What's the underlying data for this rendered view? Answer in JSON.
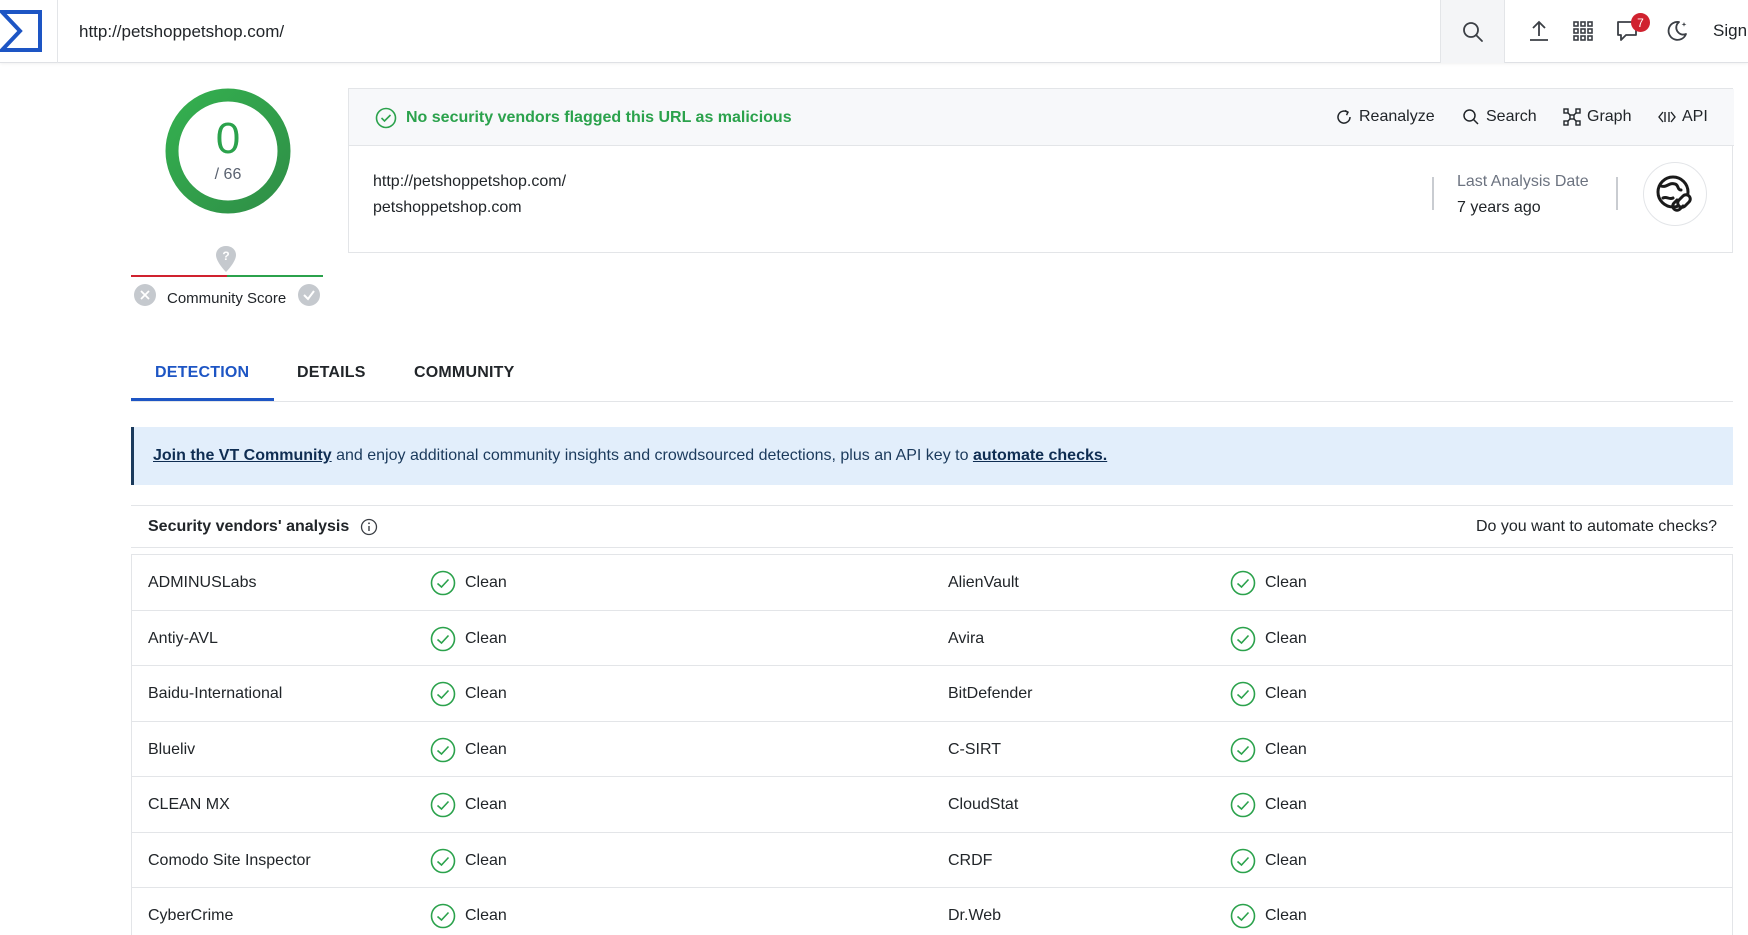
{
  "header": {
    "url_value": "http://petshoppetshop.com/",
    "notification_count": "7",
    "signin_label": "Sign"
  },
  "score": {
    "detections": "0",
    "total": "/ 66",
    "community_label": "Community Score"
  },
  "summary": {
    "status_text": "No security vendors flagged this URL as malicious",
    "actions": [
      "Reanalyze",
      "Search",
      "Graph",
      "API"
    ],
    "url": "http://petshoppetshop.com/",
    "domain": "petshoppetshop.com",
    "last_analysis_label": "Last Analysis Date",
    "last_analysis_value": "7 years ago"
  },
  "tabs": [
    "DETECTION",
    "DETAILS",
    "COMMUNITY"
  ],
  "banner": {
    "link1": "Join the VT Community",
    "middle": " and enjoy additional community insights and crowdsourced detections, plus an API key to ",
    "link2": "automate checks."
  },
  "vendors": {
    "title": "Security vendors' analysis",
    "automate_prompt": "Do you want to automate checks?",
    "rows": [
      {
        "left_name": "ADMINUSLabs",
        "left_result": "Clean",
        "right_name": "AlienVault",
        "right_result": "Clean"
      },
      {
        "left_name": "Antiy-AVL",
        "left_result": "Clean",
        "right_name": "Avira",
        "right_result": "Clean"
      },
      {
        "left_name": "Baidu-International",
        "left_result": "Clean",
        "right_name": "BitDefender",
        "right_result": "Clean"
      },
      {
        "left_name": "Blueliv",
        "left_result": "Clean",
        "right_name": "C-SIRT",
        "right_result": "Clean"
      },
      {
        "left_name": "CLEAN MX",
        "left_result": "Clean",
        "right_name": "CloudStat",
        "right_result": "Clean"
      },
      {
        "left_name": "Comodo Site Inspector",
        "left_result": "Clean",
        "right_name": "CRDF",
        "right_result": "Clean"
      },
      {
        "left_name": "CyberCrime",
        "left_result": "Clean",
        "right_name": "Dr.Web",
        "right_result": "Clean"
      }
    ]
  },
  "colors": {
    "clean_green": "#2ba24c",
    "accent_blue": "#1d55c4",
    "alert_red": "#d0222f",
    "banner_bg": "#e2eefb"
  },
  "icons": {
    "logo": "virustotal-logo-icon",
    "search": "search-icon",
    "upload": "upload-icon",
    "apps": "grid-icon",
    "notifications": "chat-bubble-icon",
    "theme": "moon-icon",
    "status": "check-circle-icon",
    "reanalyze": "refresh-icon",
    "graph": "graph-icon",
    "api": "api-icon",
    "url_badge": "link-globe-icon",
    "vendor_result": "check-circle-icon"
  }
}
